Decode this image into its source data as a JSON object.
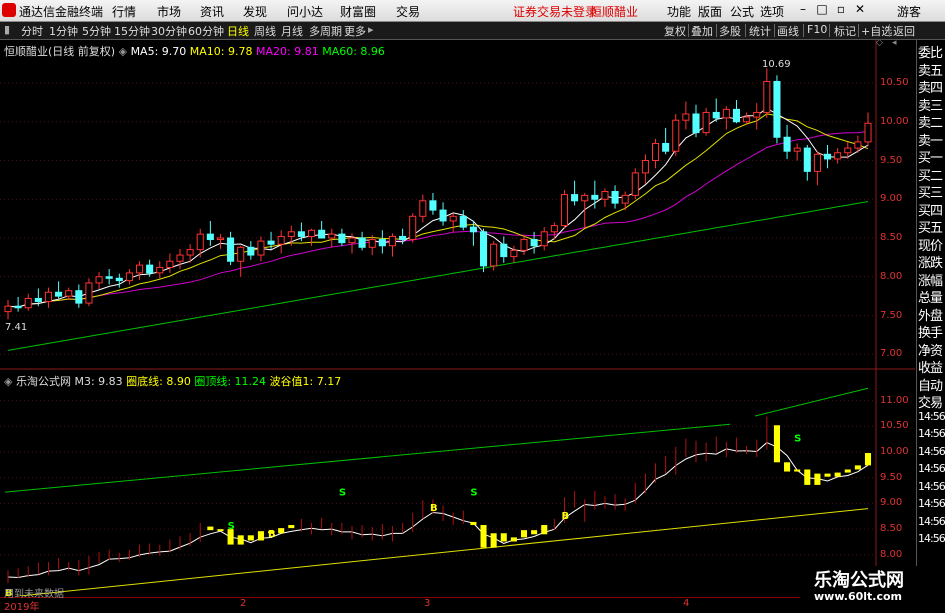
{
  "menubar": {
    "app_name": "通达信金融终端",
    "items": [
      "行情",
      "市场",
      "资讯",
      "发现",
      "问小达",
      "财富圈",
      "交易"
    ],
    "status_text": "证券交易未登录",
    "stock_name": "恒顺醋业",
    "right_items": [
      "功能",
      "版面",
      "公式",
      "选项"
    ],
    "guest": "游客"
  },
  "toolbar": {
    "periods": [
      "分时",
      "1分钟",
      "5分钟",
      "15分钟",
      "30分钟",
      "60分钟",
      "日线",
      "周线",
      "月线",
      "多周期",
      "更多"
    ],
    "active_period": "日线",
    "right_buttons": [
      "复权",
      "叠加",
      "多股",
      "统计",
      "画线",
      "F10",
      "标记",
      "+自选",
      "返回"
    ]
  },
  "main_legend": {
    "title": "恒顺醋业(日线 前复权)",
    "ma5": "MA5: 9.70",
    "ma10": "MA10: 9.78",
    "ma20": "MA20: 9.81",
    "ma60": "MA60: 8.96",
    "high_label": "10.69",
    "low_label": "7.41",
    "colors": {
      "ma5": "#ffffff",
      "ma10": "#ffff00",
      "ma20": "#ff00ff",
      "ma60": "#00ff00"
    }
  },
  "main_axis": [
    "10.50",
    "10.00",
    "9.50",
    "9.00",
    "8.50",
    "8.00",
    "7.50",
    "7.00"
  ],
  "sub_legend": {
    "title": "乐淘公式网",
    "m3": "M3: 9.83",
    "bottom_line": "圈底线: 8.90",
    "top_line": "圈顶线: 11.24",
    "valley": "波谷值1: 7.17"
  },
  "sub_axis": [
    "11.00",
    "10.50",
    "10.00",
    "9.50",
    "9.00",
    "8.50",
    "8.00"
  ],
  "sub_markers": {
    "s": "S",
    "b": "B"
  },
  "right_panel": [
    "委比",
    "卖五",
    "卖四",
    "卖三",
    "卖二",
    "卖一",
    "买一",
    "买二",
    "买三",
    "买四",
    "买五",
    "现价",
    "涨跌",
    "涨幅",
    "总量",
    "外盘",
    "换手",
    "净资",
    "收益",
    "自动",
    "交易",
    "14:56",
    "14:56",
    "14:56",
    "14:56",
    "14:56",
    "14:56",
    "14:56",
    "14:56"
  ],
  "bottom": {
    "future_label": "用到未来数据",
    "dates": [
      "2019年",
      "2",
      "3",
      "4"
    ]
  },
  "watermark": {
    "name": "乐淘公式网",
    "url": "www.60lt.com"
  },
  "chart_data": {
    "type": "candlestick",
    "ylim": [
      6.9,
      10.9
    ],
    "ohlc": [
      [
        7.55,
        7.7,
        7.45,
        7.62
      ],
      [
        7.62,
        7.74,
        7.55,
        7.6
      ],
      [
        7.6,
        7.78,
        7.56,
        7.72
      ],
      [
        7.72,
        7.85,
        7.62,
        7.68
      ],
      [
        7.68,
        7.86,
        7.6,
        7.8
      ],
      [
        7.8,
        7.94,
        7.72,
        7.75
      ],
      [
        7.75,
        7.86,
        7.7,
        7.82
      ],
      [
        7.82,
        7.9,
        7.6,
        7.66
      ],
      [
        7.66,
        7.98,
        7.62,
        7.92
      ],
      [
        7.92,
        8.06,
        7.84,
        8.0
      ],
      [
        8.0,
        8.1,
        7.9,
        7.98
      ],
      [
        7.98,
        8.04,
        7.86,
        7.95
      ],
      [
        7.95,
        8.1,
        7.9,
        8.05
      ],
      [
        8.05,
        8.2,
        7.96,
        8.15
      ],
      [
        8.15,
        8.22,
        8.0,
        8.05
      ],
      [
        8.05,
        8.2,
        7.98,
        8.12
      ],
      [
        8.12,
        8.3,
        8.05,
        8.2
      ],
      [
        8.2,
        8.36,
        8.1,
        8.28
      ],
      [
        8.28,
        8.42,
        8.18,
        8.35
      ],
      [
        8.35,
        8.62,
        8.25,
        8.55
      ],
      [
        8.55,
        8.72,
        8.4,
        8.48
      ],
      [
        8.48,
        8.55,
        8.36,
        8.5
      ],
      [
        8.5,
        8.58,
        8.15,
        8.2
      ],
      [
        8.2,
        8.4,
        8.0,
        8.38
      ],
      [
        8.38,
        8.46,
        8.22,
        8.28
      ],
      [
        8.28,
        8.52,
        8.2,
        8.46
      ],
      [
        8.46,
        8.58,
        8.36,
        8.42
      ],
      [
        8.42,
        8.6,
        8.3,
        8.52
      ],
      [
        8.52,
        8.66,
        8.4,
        8.58
      ],
      [
        8.58,
        8.7,
        8.46,
        8.52
      ],
      [
        8.52,
        8.62,
        8.4,
        8.6
      ],
      [
        8.6,
        8.72,
        8.5,
        8.5
      ],
      [
        8.5,
        8.62,
        8.38,
        8.55
      ],
      [
        8.55,
        8.62,
        8.4,
        8.44
      ],
      [
        8.44,
        8.56,
        8.3,
        8.5
      ],
      [
        8.5,
        8.58,
        8.34,
        8.38
      ],
      [
        8.38,
        8.54,
        8.28,
        8.48
      ],
      [
        8.48,
        8.6,
        8.3,
        8.4
      ],
      [
        8.4,
        8.56,
        8.26,
        8.52
      ],
      [
        8.52,
        8.62,
        8.42,
        8.48
      ],
      [
        8.48,
        8.82,
        8.44,
        8.78
      ],
      [
        8.78,
        9.06,
        8.7,
        8.98
      ],
      [
        8.98,
        9.08,
        8.8,
        8.86
      ],
      [
        8.86,
        8.96,
        8.66,
        8.72
      ],
      [
        8.72,
        8.82,
        8.58,
        8.78
      ],
      [
        8.78,
        8.86,
        8.6,
        8.64
      ],
      [
        8.64,
        8.72,
        8.4,
        8.58
      ],
      [
        8.58,
        8.62,
        8.06,
        8.14
      ],
      [
        8.14,
        8.46,
        8.08,
        8.42
      ],
      [
        8.42,
        8.52,
        8.18,
        8.26
      ],
      [
        8.26,
        8.4,
        8.18,
        8.34
      ],
      [
        8.34,
        8.54,
        8.28,
        8.48
      ],
      [
        8.48,
        8.58,
        8.3,
        8.4
      ],
      [
        8.4,
        8.64,
        8.34,
        8.58
      ],
      [
        8.58,
        8.7,
        8.48,
        8.66
      ],
      [
        8.66,
        9.12,
        8.62,
        9.06
      ],
      [
        9.06,
        9.24,
        8.92,
        8.98
      ],
      [
        8.98,
        9.08,
        8.64,
        9.05
      ],
      [
        9.05,
        9.24,
        8.88,
        9.0
      ],
      [
        9.0,
        9.14,
        8.9,
        9.1
      ],
      [
        9.1,
        9.18,
        8.88,
        8.95
      ],
      [
        8.95,
        9.1,
        8.86,
        9.05
      ],
      [
        9.05,
        9.4,
        9.0,
        9.34
      ],
      [
        9.34,
        9.58,
        9.2,
        9.5
      ],
      [
        9.5,
        9.78,
        9.4,
        9.72
      ],
      [
        9.72,
        9.92,
        9.58,
        9.62
      ],
      [
        9.62,
        10.1,
        9.56,
        10.02
      ],
      [
        10.02,
        10.26,
        9.9,
        10.1
      ],
      [
        10.1,
        10.22,
        9.8,
        9.86
      ],
      [
        9.86,
        10.18,
        9.82,
        10.12
      ],
      [
        10.12,
        10.3,
        10.0,
        10.05
      ],
      [
        10.05,
        10.2,
        9.9,
        10.16
      ],
      [
        10.16,
        10.28,
        9.98,
        10.0
      ],
      [
        10.0,
        10.12,
        9.96,
        10.06
      ],
      [
        10.06,
        10.24,
        9.9,
        10.12
      ],
      [
        10.12,
        10.69,
        10.05,
        10.52
      ],
      [
        10.52,
        10.6,
        9.72,
        9.8
      ],
      [
        9.8,
        9.96,
        9.52,
        9.62
      ],
      [
        9.62,
        9.72,
        9.5,
        9.66
      ],
      [
        9.66,
        9.7,
        9.24,
        9.36
      ],
      [
        9.36,
        9.62,
        9.18,
        9.58
      ],
      [
        9.58,
        9.7,
        9.4,
        9.52
      ],
      [
        9.52,
        9.66,
        9.46,
        9.6
      ],
      [
        9.6,
        9.74,
        9.52,
        9.66
      ],
      [
        9.66,
        9.82,
        9.6,
        9.74
      ],
      [
        9.74,
        10.12,
        9.68,
        9.98
      ]
    ]
  }
}
